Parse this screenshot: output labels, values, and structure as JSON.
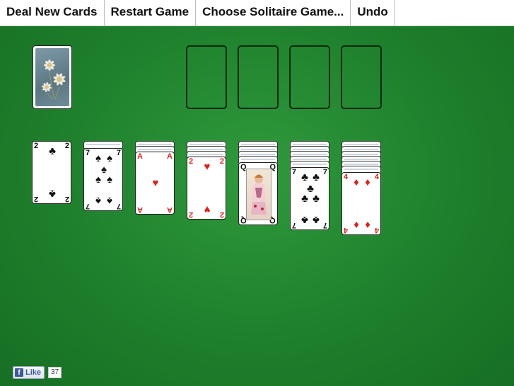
{
  "menu": [
    {
      "label": "Deal New Cards"
    },
    {
      "label": "Restart Game"
    },
    {
      "label": "Choose Solitaire Game..."
    },
    {
      "label": "Undo"
    }
  ],
  "stock": {
    "face": "down",
    "back_art": "edelweiss-flowers"
  },
  "foundations": [
    {},
    {},
    {},
    {}
  ],
  "tableau": [
    {
      "hidden": 0,
      "top": {
        "rank": "2",
        "suit": "♣",
        "color": "black"
      }
    },
    {
      "hidden": 1,
      "top": {
        "rank": "7",
        "suit": "♠",
        "color": "black"
      }
    },
    {
      "hidden": 2,
      "top": {
        "rank": "A",
        "suit": "♥",
        "color": "red"
      }
    },
    {
      "hidden": 3,
      "top": {
        "rank": "2",
        "suit": "♥",
        "color": "red"
      }
    },
    {
      "hidden": 4,
      "top": {
        "rank": "Q",
        "suit": "♦",
        "color": "red",
        "art": "queen-portrait"
      }
    },
    {
      "hidden": 5,
      "top": {
        "rank": "7",
        "suit": "♣",
        "color": "black"
      }
    },
    {
      "hidden": 6,
      "top": {
        "rank": "4",
        "suit": "♦",
        "color": "red"
      }
    }
  ],
  "facebook": {
    "like_label": "Like",
    "count": "37",
    "icon": "f"
  },
  "colors": {
    "felt": "#1e7f2c",
    "red": "#e0201c"
  }
}
